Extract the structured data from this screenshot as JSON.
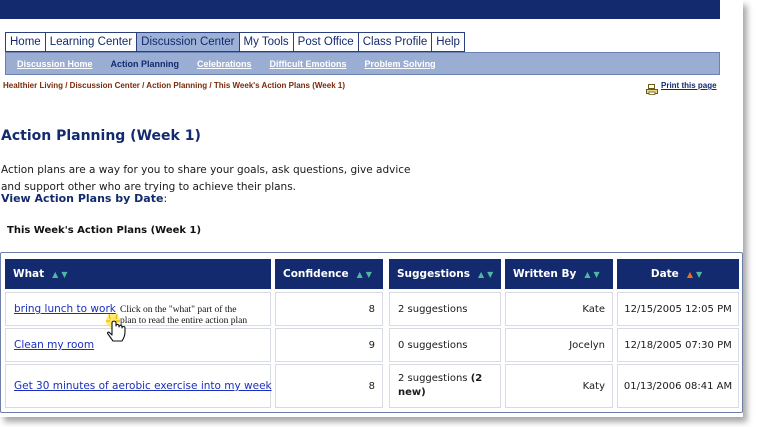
{
  "tabs": [
    {
      "label": "Home",
      "active": false
    },
    {
      "label": "Learning Center",
      "active": false
    },
    {
      "label": "Discussion Center",
      "active": true
    },
    {
      "label": "My Tools",
      "active": false
    },
    {
      "label": "Post Office",
      "active": false
    },
    {
      "label": "Class Profile",
      "active": false
    },
    {
      "label": "Help",
      "active": false
    }
  ],
  "subnav": [
    {
      "label": "Discussion Home",
      "current": false
    },
    {
      "label": "Action Planning",
      "current": true
    },
    {
      "label": "Celebrations",
      "current": false
    },
    {
      "label": "Difficult Emotions",
      "current": false
    },
    {
      "label": "Problem Solving",
      "current": false
    }
  ],
  "breadcrumb": "Healthier Living / Discussion Center / Action Planning / This Week's Action Plans (Week 1)",
  "print_label": "Print this page",
  "page_title": "Action Planning (Week 1)",
  "intro_line1": "Action plans are a way for you to share your goals, ask questions, give advice",
  "intro_line2": "and support other who are trying to achieve their plans.",
  "view_link": "View Action Plans by Date",
  "view_colon": ":",
  "table_caption": "This Week's Action Plans (Week 1)",
  "columns": {
    "what": "What",
    "confidence": "Confidence",
    "suggestions": "Suggestions",
    "written_by": "Written By",
    "date": "Date",
    "sort_up": "▲",
    "sort_down": "▼"
  },
  "rows": [
    {
      "what": "bring lunch to work",
      "confidence": "8",
      "suggestions": "2 suggestions",
      "suggestions_new": "",
      "written_by": "Kate",
      "date": "12/15/2005 12:05 PM"
    },
    {
      "what": "Clean my room",
      "confidence": "9",
      "suggestions": "0 suggestions",
      "suggestions_new": "",
      "written_by": "Jocelyn",
      "date": "12/18/2005 07:30 PM"
    },
    {
      "what": "Get 30 minutes of aerobic exercise into my week",
      "confidence": "8",
      "suggestions": "2 suggestions",
      "suggestions_new": "(2 new)",
      "written_by": "Katy",
      "date": "01/13/2006 08:41 AM"
    }
  ],
  "callout_line1": "Click  on the \"what\" part of the",
  "callout_line2": "plan to read the entire action plan",
  "colors": {
    "navy": "#132a6e",
    "subnav": "#9aaed4",
    "link": "#1a2fbf",
    "breadcrumb": "#7a2a0a",
    "sort_active": "#e87020",
    "sort_idle": "#4fb8a0"
  },
  "icons": {
    "print": "printer-icon",
    "cursor": "hand-pointer-icon"
  }
}
